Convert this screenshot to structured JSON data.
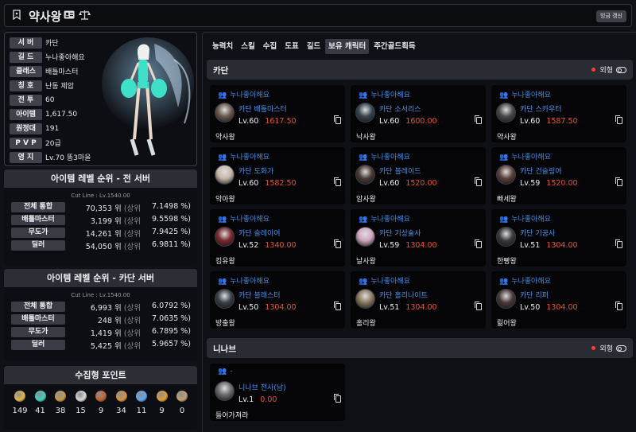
{
  "header": {
    "title": "약사왕",
    "refresh_label": "빙금 갱신",
    "profile_icon": "id-card-icon",
    "scale_icon": "scale-icon"
  },
  "character": {
    "fields": [
      {
        "label": "서 버",
        "value": "카단"
      },
      {
        "label": "길 드",
        "value": "누나좋아해요"
      },
      {
        "label": "클래스",
        "value": "배틀마스터"
      },
      {
        "label": "칭 호",
        "value": "난동 제압"
      },
      {
        "label": "전 투",
        "value": "60"
      },
      {
        "label": "아이템",
        "value": "1,617.50"
      },
      {
        "label": "원정대",
        "value": "191"
      },
      {
        "label": "P V P",
        "value": "20급"
      },
      {
        "label": "영 지",
        "value": "Lv.70 똥3마을"
      }
    ]
  },
  "rank_all": {
    "title": "아이템 레벨 순위 - 전 서버",
    "cutline": "Cut Line : Lv.1540.00",
    "rows": [
      {
        "label": "전체 통합",
        "rank": "70,353 위",
        "sub": "(상위",
        "pct": "7.1498 %)"
      },
      {
        "label": "배틀마스터",
        "rank": "3,199 위",
        "sub": "(상위",
        "pct": "9.5598 %)"
      },
      {
        "label": "무도가",
        "rank": "14,261 위",
        "sub": "(상위",
        "pct": "7.9425 %)"
      },
      {
        "label": "딜러",
        "rank": "54,050 위",
        "sub": "(상위",
        "pct": "6.9811 %)"
      }
    ]
  },
  "rank_server": {
    "title": "아이템 레벨 순위 - 카단 서버",
    "cutline": "Cut Line : Lv.1540.00",
    "rows": [
      {
        "label": "전체 통합",
        "rank": "6,993 위",
        "sub": "(상위",
        "pct": "6.0792 %)"
      },
      {
        "label": "배틀마스터",
        "rank": "248 위",
        "sub": "(상위",
        "pct": "7.0635 %)"
      },
      {
        "label": "무도가",
        "rank": "1,419 위",
        "sub": "(상위",
        "pct": "6.7895 %)"
      },
      {
        "label": "딜러",
        "rank": "5,425 위",
        "sub": "(상위",
        "pct": "5.9657 %)"
      }
    ]
  },
  "collection": {
    "title": "수집형 포인트",
    "items": [
      {
        "icon": "seed-icon",
        "value": "149",
        "color": "#e0b84a"
      },
      {
        "icon": "island-heart-icon",
        "value": "41",
        "color": "#3fd0c0"
      },
      {
        "icon": "art-icon",
        "value": "38",
        "color": "#c89a4a"
      },
      {
        "icon": "giant-heart-icon",
        "value": "15",
        "color": "#d8d8d8"
      },
      {
        "icon": "ignea-icon",
        "value": "9",
        "color": "#c06030"
      },
      {
        "icon": "voyage-icon",
        "value": "34",
        "color": "#d89040"
      },
      {
        "icon": "world-tree-leaf-icon",
        "value": "11",
        "color": "#5fa8f0"
      },
      {
        "icon": "orpheus-star-icon",
        "value": "9",
        "color": "#e0a030"
      },
      {
        "icon": "mokoko-medal-icon",
        "value": "0",
        "color": "#c0a070"
      }
    ]
  },
  "tabs": [
    "능력치",
    "스킬",
    "수집",
    "도표",
    "길드",
    "보유 캐릭터",
    "주간골드획득"
  ],
  "active_tab": 5,
  "servers": [
    {
      "name": "카단",
      "look_label": "외형",
      "characters": [
        {
          "guild": "누나좋아해요",
          "server": "카단",
          "class": "배틀마스터",
          "level": "Lv.60",
          "ilvl": "1617.50",
          "name": "약사왕",
          "avatar_color": "#6a5a50"
        },
        {
          "guild": "누나좋아해요",
          "server": "카단",
          "class": "소서리스",
          "level": "Lv.60",
          "ilvl": "1600.00",
          "name": "낙사왕",
          "avatar_color": "#3a4550"
        },
        {
          "guild": "누나좋아해요",
          "server": "카단",
          "class": "스카우터",
          "level": "Lv.60",
          "ilvl": "1587.50",
          "name": "약사왕",
          "avatar_color": "#4a4a4a"
        },
        {
          "guild": "누나좋아해요",
          "server": "카단",
          "class": "도화가",
          "level": "Lv.60",
          "ilvl": "1582.50",
          "name": "악아왕",
          "avatar_color": "#c8b8a8"
        },
        {
          "guild": "누나좋아해요",
          "server": "카단",
          "class": "블레이드",
          "level": "Lv.60",
          "ilvl": "1520.00",
          "name": "암사왕",
          "avatar_color": "#4a3a35"
        },
        {
          "guild": "누나좋아해요",
          "server": "카단",
          "class": "건슬링어",
          "level": "Lv.59",
          "ilvl": "1520.00",
          "name": "빠세왕",
          "avatar_color": "#5a4038"
        },
        {
          "guild": "누나좋아해요",
          "server": "카단",
          "class": "슬레이어",
          "level": "Lv.52",
          "ilvl": "1340.00",
          "name": "킹유왕",
          "avatar_color": "#7a2a30"
        },
        {
          "guild": "누나좋아해요",
          "server": "카단",
          "class": "기상술사",
          "level": "Lv.59",
          "ilvl": "1304.00",
          "name": "날사왕",
          "avatar_color": "#d0a8c0"
        },
        {
          "guild": "누나좋아해요",
          "server": "카단",
          "class": "기공사",
          "level": "Lv.51",
          "ilvl": "1304.00",
          "name": "한빵왕",
          "avatar_color": "#3a3a3e"
        },
        {
          "guild": "누나좋아해요",
          "server": "카단",
          "class": "블래스터",
          "level": "Lv.50",
          "ilvl": "1304.00",
          "name": "방출왕",
          "avatar_color": "#3a4048"
        },
        {
          "guild": "누나좋아해요",
          "server": "카단",
          "class": "홀리나이트",
          "level": "Lv.51",
          "ilvl": "1304.00",
          "name": "홀리왕",
          "avatar_color": "#8a7a60"
        },
        {
          "guild": "누나좋아해요",
          "server": "카단",
          "class": "리퍼",
          "level": "Lv.50",
          "ilvl": "1304.00",
          "name": "릶어왕",
          "avatar_color": "#4a3a3a"
        }
      ]
    },
    {
      "name": "니나브",
      "look_label": "외형",
      "characters": [
        {
          "guild": "-",
          "server": "니나브",
          "class": "전사(남)",
          "level": "Lv.1",
          "ilvl": "0.00",
          "name": "들어가져라",
          "avatar_color": "#6a6a70"
        }
      ]
    }
  ]
}
